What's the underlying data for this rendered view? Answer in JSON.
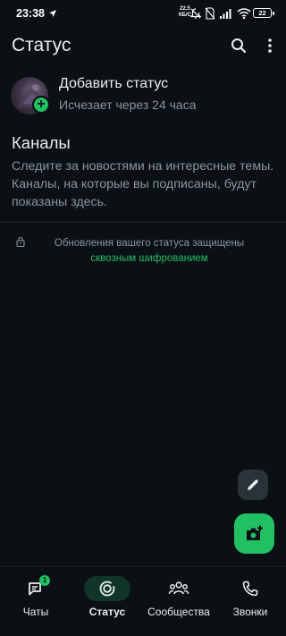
{
  "status_bar": {
    "time": "23:38",
    "net_speed_value": "22,5",
    "net_speed_unit": "КБ/С",
    "battery": "22"
  },
  "header": {
    "title": "Статус",
    "icons": [
      "search-icon",
      "more-vert-icon"
    ]
  },
  "my_status": {
    "title": "Добавить статус",
    "subtitle": "Исчезает через 24 часа",
    "badge": "+"
  },
  "channels": {
    "title": "Каналы",
    "description": "Следите за новостями на интересные темы. Каналы, на которые вы подписаны, будут показаны здесь."
  },
  "encryption": {
    "text": "Обновления вашего статуса защищены",
    "link": "сквозным шифрованием"
  },
  "fabs": {
    "small_icon": "pencil-icon",
    "main_icon": "camera-add-icon"
  },
  "bottom_nav": {
    "items": [
      {
        "label": "Чаты",
        "icon": "chats-icon",
        "badge": "1",
        "active": false
      },
      {
        "label": "Статус",
        "icon": "status-icon",
        "active": true
      },
      {
        "label": "Сообщества",
        "icon": "communities-icon",
        "active": false
      },
      {
        "label": "Звонки",
        "icon": "calls-icon",
        "active": false
      }
    ]
  },
  "colors": {
    "background": "#0b1014",
    "accent": "#21c063",
    "text_primary": "#e9edef",
    "text_secondary": "#8696a0",
    "active_pill": "#103529"
  }
}
